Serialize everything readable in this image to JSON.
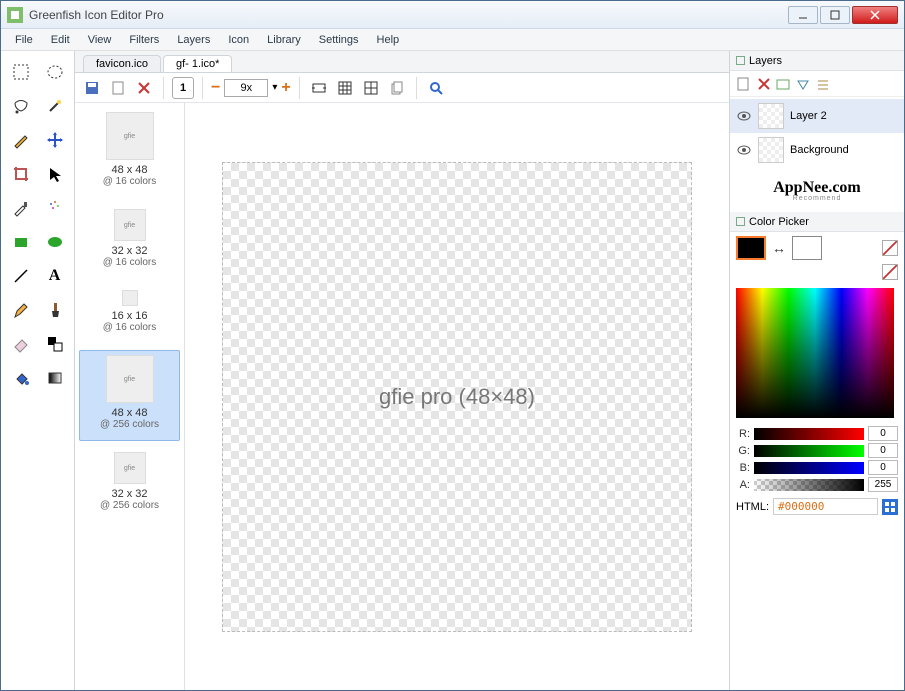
{
  "window": {
    "title": "Greenfish Icon Editor Pro"
  },
  "menu": [
    "File",
    "Edit",
    "View",
    "Filters",
    "Layers",
    "Icon",
    "Library",
    "Settings",
    "Help"
  ],
  "tabs": [
    {
      "label": "favicon.ico",
      "active": false
    },
    {
      "label": "gf- 1.ico*",
      "active": true
    }
  ],
  "toolbar": {
    "frame_count": "1",
    "zoom": "9x"
  },
  "frames": [
    {
      "size": "48 x 48",
      "colors": "@ 16 colors",
      "thumb": "s48",
      "selected": false
    },
    {
      "size": "32 x 32",
      "colors": "@ 16 colors",
      "thumb": "s32",
      "selected": false
    },
    {
      "size": "16 x 16",
      "colors": "@ 16 colors",
      "thumb": "s16",
      "selected": false
    },
    {
      "size": "48 x 48",
      "colors": "@ 256 colors",
      "thumb": "s48",
      "selected": true
    },
    {
      "size": "32 x 32",
      "colors": "@ 256 colors",
      "thumb": "s32",
      "selected": false
    }
  ],
  "layers_panel": {
    "title": "Layers",
    "items": [
      {
        "name": "Layer 2",
        "selected": true
      },
      {
        "name": "Background",
        "selected": false
      }
    ]
  },
  "watermark": {
    "brand": "AppNee",
    "tld": ".com",
    "tag": "Recommend"
  },
  "picker": {
    "title": "Color Picker",
    "r": "0",
    "g": "0",
    "b": "0",
    "a": "255",
    "html_label": "HTML:",
    "html": "#000000",
    "labels": {
      "r": "R:",
      "g": "G:",
      "b": "B:",
      "a": "A:"
    }
  },
  "canvas_placeholder": "gfie pro (48×48)"
}
